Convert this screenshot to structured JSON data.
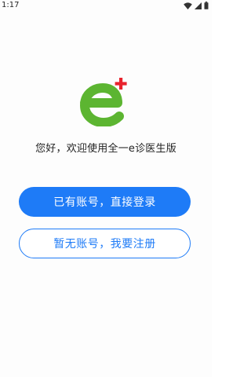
{
  "status_bar": {
    "time": "1:17",
    "icons": [
      "wifi-icon",
      "cellular-signal-icon",
      "battery-icon"
    ]
  },
  "logo": {
    "icon": "e-plus-logo",
    "colors": {
      "e": "#5cb531",
      "plus": "#e8232d"
    }
  },
  "welcome_text": "您好，欢迎使用全一e诊医生版",
  "buttons": {
    "login_label": "已有账号，直接登录",
    "register_label": "暂无账号，我要注册"
  },
  "colors": {
    "primary": "#1e7bf7",
    "background": "#fdfdfd"
  }
}
